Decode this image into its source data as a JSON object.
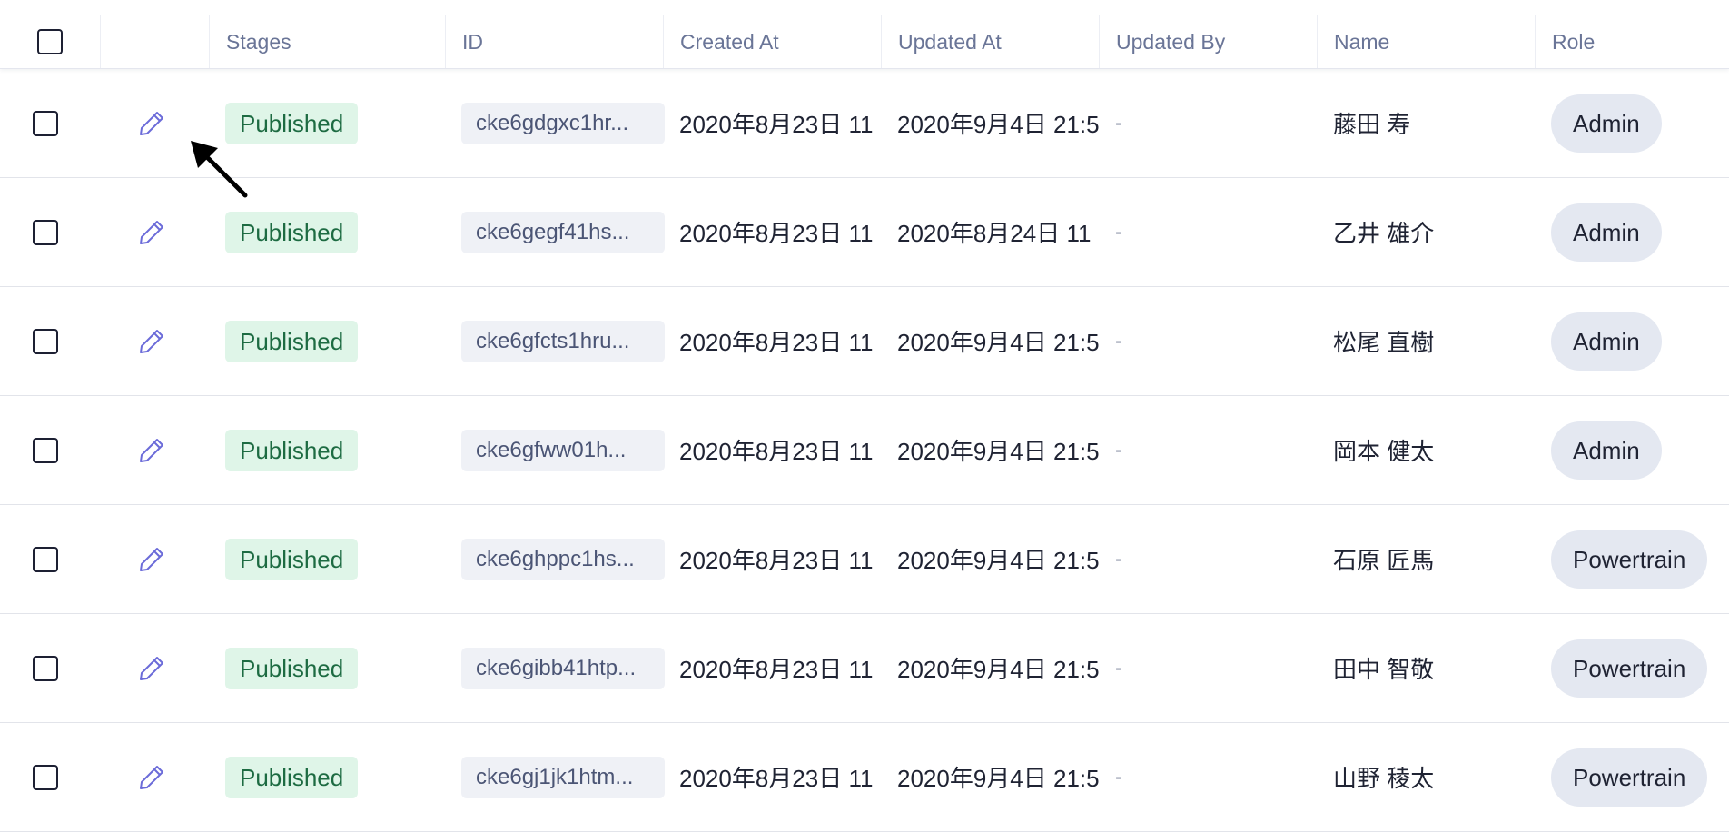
{
  "columns": {
    "stages": "Stages",
    "id": "ID",
    "created_at": "Created At",
    "updated_at": "Updated At",
    "updated_by": "Updated By",
    "name": "Name",
    "role": "Role"
  },
  "rows": [
    {
      "stage": "Published",
      "id": "cke6gdgxc1hr...",
      "created_at": "2020年8月23日 11",
      "updated_at": "2020年9月4日 21:5",
      "updated_by": "-",
      "name": "藤田 寿",
      "role": "Admin"
    },
    {
      "stage": "Published",
      "id": "cke6gegf41hs...",
      "created_at": "2020年8月23日 11",
      "updated_at": "2020年8月24日 11",
      "updated_by": "-",
      "name": "乙井 雄介",
      "role": "Admin"
    },
    {
      "stage": "Published",
      "id": "cke6gfcts1hru...",
      "created_at": "2020年8月23日 11",
      "updated_at": "2020年9月4日 21:5",
      "updated_by": "-",
      "name": "松尾 直樹",
      "role": "Admin"
    },
    {
      "stage": "Published",
      "id": "cke6gfww01h...",
      "created_at": "2020年8月23日 11",
      "updated_at": "2020年9月4日 21:5",
      "updated_by": "-",
      "name": "岡本 健太",
      "role": "Admin"
    },
    {
      "stage": "Published",
      "id": "cke6ghppc1hs...",
      "created_at": "2020年8月23日 11",
      "updated_at": "2020年9月4日 21:5",
      "updated_by": "-",
      "name": "石原 匠馬",
      "role": "Powertrain"
    },
    {
      "stage": "Published",
      "id": "cke6gibb41htp...",
      "created_at": "2020年8月23日 11",
      "updated_at": "2020年9月4日 21:5",
      "updated_by": "-",
      "name": "田中 智敬",
      "role": "Powertrain"
    },
    {
      "stage": "Published",
      "id": "cke6gj1jk1htm...",
      "created_at": "2020年8月23日 11",
      "updated_at": "2020年9月4日 21:5",
      "updated_by": "-",
      "name": "山野 稜太",
      "role": "Powertrain"
    }
  ],
  "icons": {
    "edit": "pencil-icon",
    "cursor": "arrow-cursor-icon"
  },
  "colors": {
    "accent_icon": "#6b6bd9",
    "stage_bg": "#dff5e8",
    "stage_text": "#1d6b42",
    "role_bg": "#e4e8f1"
  }
}
